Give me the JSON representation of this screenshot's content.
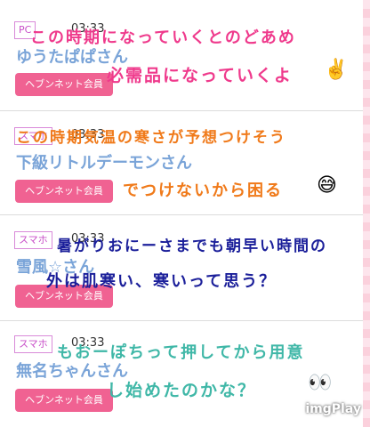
{
  "posts": [
    {
      "badge": "PC",
      "time": "03:33",
      "name": "ゆうたぱぱさん",
      "member": "ヘブンネット会員",
      "overlay_lines": [
        "この時期になっていくとのどあめ",
        "必需品になっていくよ"
      ],
      "emoji": "✌️"
    },
    {
      "badge": "スマホ",
      "time": "03:33",
      "name": "下級リトルデーモンさん",
      "member": "ヘブンネット会員",
      "overlay_lines": [
        "この時期気温の寒さが予想つけそう",
        "でつけないから困る"
      ],
      "emoji": "😅"
    },
    {
      "badge": "スマホ",
      "time": "03:33",
      "name": "雪風☆さん",
      "member": "ヘブンネット会員",
      "overlay_lines": [
        "暑がりおにーさまでも朝早い時間の",
        "外は肌寒い、寒いって思う？"
      ],
      "emoji": ""
    },
    {
      "badge": "スマホ",
      "time": "03:33",
      "name": "無名ちゃんさん",
      "member": "ヘブンネット会員",
      "overlay_lines": [
        "もおーぽちって押してから用意",
        "し始めたのかな？"
      ],
      "emoji": "👀"
    }
  ],
  "watermark": "imgPlay",
  "colors": {
    "badge_border": "#d98ad9",
    "name": "#7aa4d8",
    "member_button": "#f06292",
    "overlay_1": "#ef3a8c",
    "overlay_2": "#f07a1a",
    "overlay_3": "#1b1f9a",
    "overlay_4": "#3fb7a7"
  }
}
